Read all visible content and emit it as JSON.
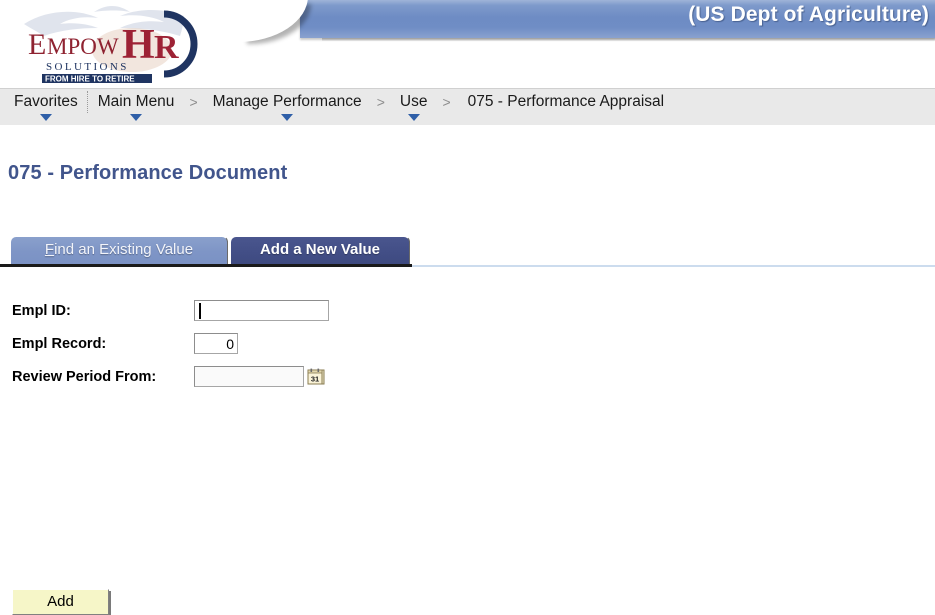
{
  "header": {
    "agency_title": "(US Dept of Agriculture)",
    "logo": {
      "word_primary": "Empow",
      "word_accent": "HR",
      "tagline_1": "S O L U T I O N S",
      "tagline_2": "FROM HIRE TO RETIRE",
      "accent_color": "#9d2235",
      "primary_color": "#8f2331",
      "ring_color": "#1f3461"
    },
    "banner_color": "#7190c6"
  },
  "navigation": {
    "items": [
      {
        "label": "Favorites",
        "has_caret": true,
        "separator_after": "dot"
      },
      {
        "label": "Main Menu",
        "has_caret": true,
        "separator_after": "gt"
      },
      {
        "label": "Manage Performance",
        "has_caret": true,
        "separator_after": "gt"
      },
      {
        "label": "Use",
        "has_caret": true,
        "separator_after": "gt"
      },
      {
        "label": "075 - Performance Appraisal",
        "has_caret": false,
        "separator_after": "none"
      }
    ],
    "separator_gt": ">"
  },
  "page": {
    "title": "075 - Performance Document",
    "title_color": "#41558c"
  },
  "tabs": [
    {
      "label": "Find an Existing Value",
      "accel": "F",
      "rest": "ind an Existing Value",
      "active": false
    },
    {
      "label": "Add a New Value",
      "accel": "",
      "rest": "Add a New Value",
      "active": true
    }
  ],
  "form": {
    "fields": [
      {
        "label": "Empl ID:",
        "value": "",
        "placeholder": "",
        "align": "left",
        "focused": true,
        "has_calendar": false
      },
      {
        "label": "Empl Record:",
        "value": "0",
        "placeholder": "",
        "align": "right",
        "focused": false,
        "has_calendar": false
      },
      {
        "label": "Review Period From:",
        "value": "",
        "placeholder": "",
        "align": "left",
        "focused": false,
        "has_calendar": true
      }
    ],
    "calendar_icon_label": "31"
  },
  "actions": {
    "add_label": "Add"
  }
}
